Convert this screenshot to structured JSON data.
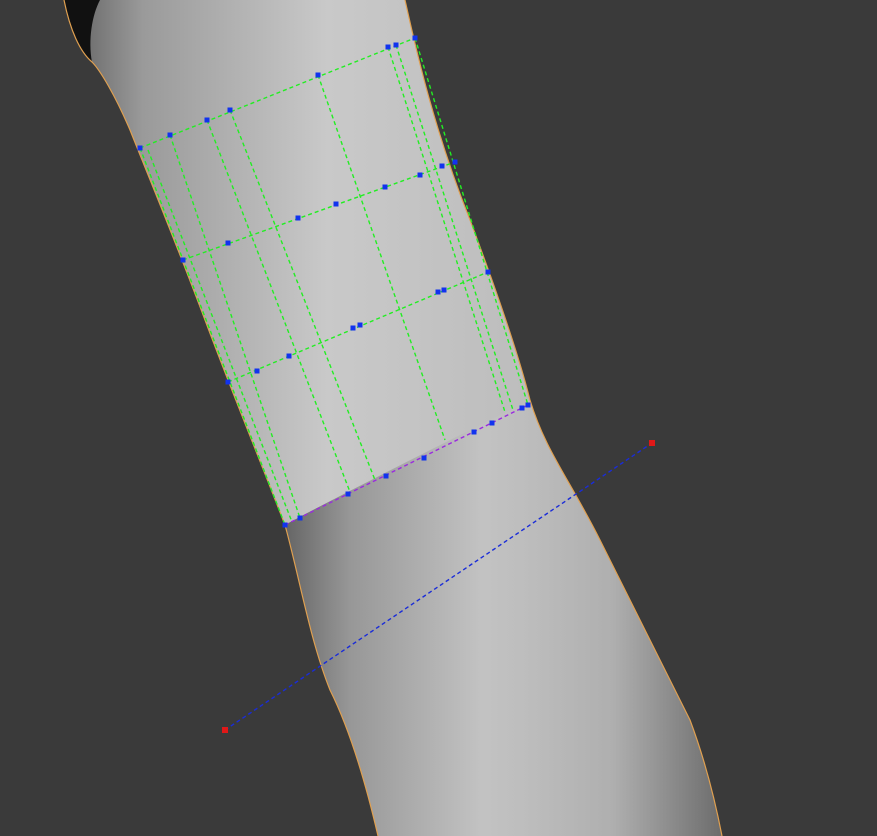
{
  "viewport": {
    "background_color": "#3a3a3a",
    "view": "perspective"
  },
  "mesh": {
    "description_icon": "mesh-surface",
    "surface_color": "#bcbcbc",
    "silhouette_color": "#e0a050"
  },
  "selection_grid": {
    "line_color": "#22ee22",
    "vertex_color": "#1133ee",
    "active_edge_color": "#9a2adf",
    "rows": 4,
    "columns": 5
  },
  "cut_line": {
    "color": "#1a2cd8",
    "endpoint_color": "#e01818",
    "endpoint_count": 2
  }
}
